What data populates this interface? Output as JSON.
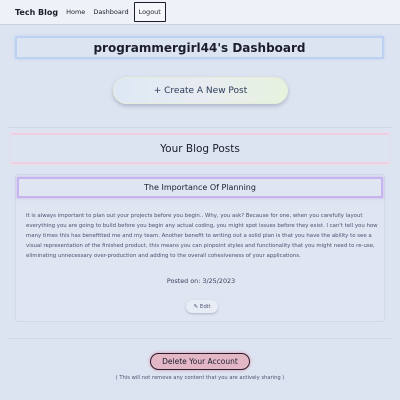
{
  "navbar": {
    "brand": "Tech Blog",
    "links": [
      {
        "label": "Home"
      },
      {
        "label": "Dashboard"
      },
      {
        "label": "Logout"
      }
    ]
  },
  "dashboard": {
    "title": "programmergirl44's Dashboard",
    "create_button": "+ Create A New Post"
  },
  "posts_section": {
    "heading": "Your Blog Posts",
    "posts": [
      {
        "title": "The Importance Of Planning",
        "body": "It is always important to plan out your projects before you begin.. Why, you ask? Because for one, when you carefully layout everything you are going to build before you begin any actual coding, you might spot issues before they exist. I can't tell you how many times this has benefitted me and my team. Another benefit to writing out a solid plan is that you have the ability to see a visual representation of the finished product, this means you can pinpoint styles and functionality that you might need to re-use, eliminating unnecessary over-production and adding to the overall cohesiveness of your applications.",
        "posted_on": "Posted on: 3/25/2023",
        "edit_label": "✎ Edit"
      }
    ]
  },
  "account": {
    "delete_button": "Delete Your Account",
    "delete_note": "( This will not remove any content that you are actively sharing )"
  }
}
